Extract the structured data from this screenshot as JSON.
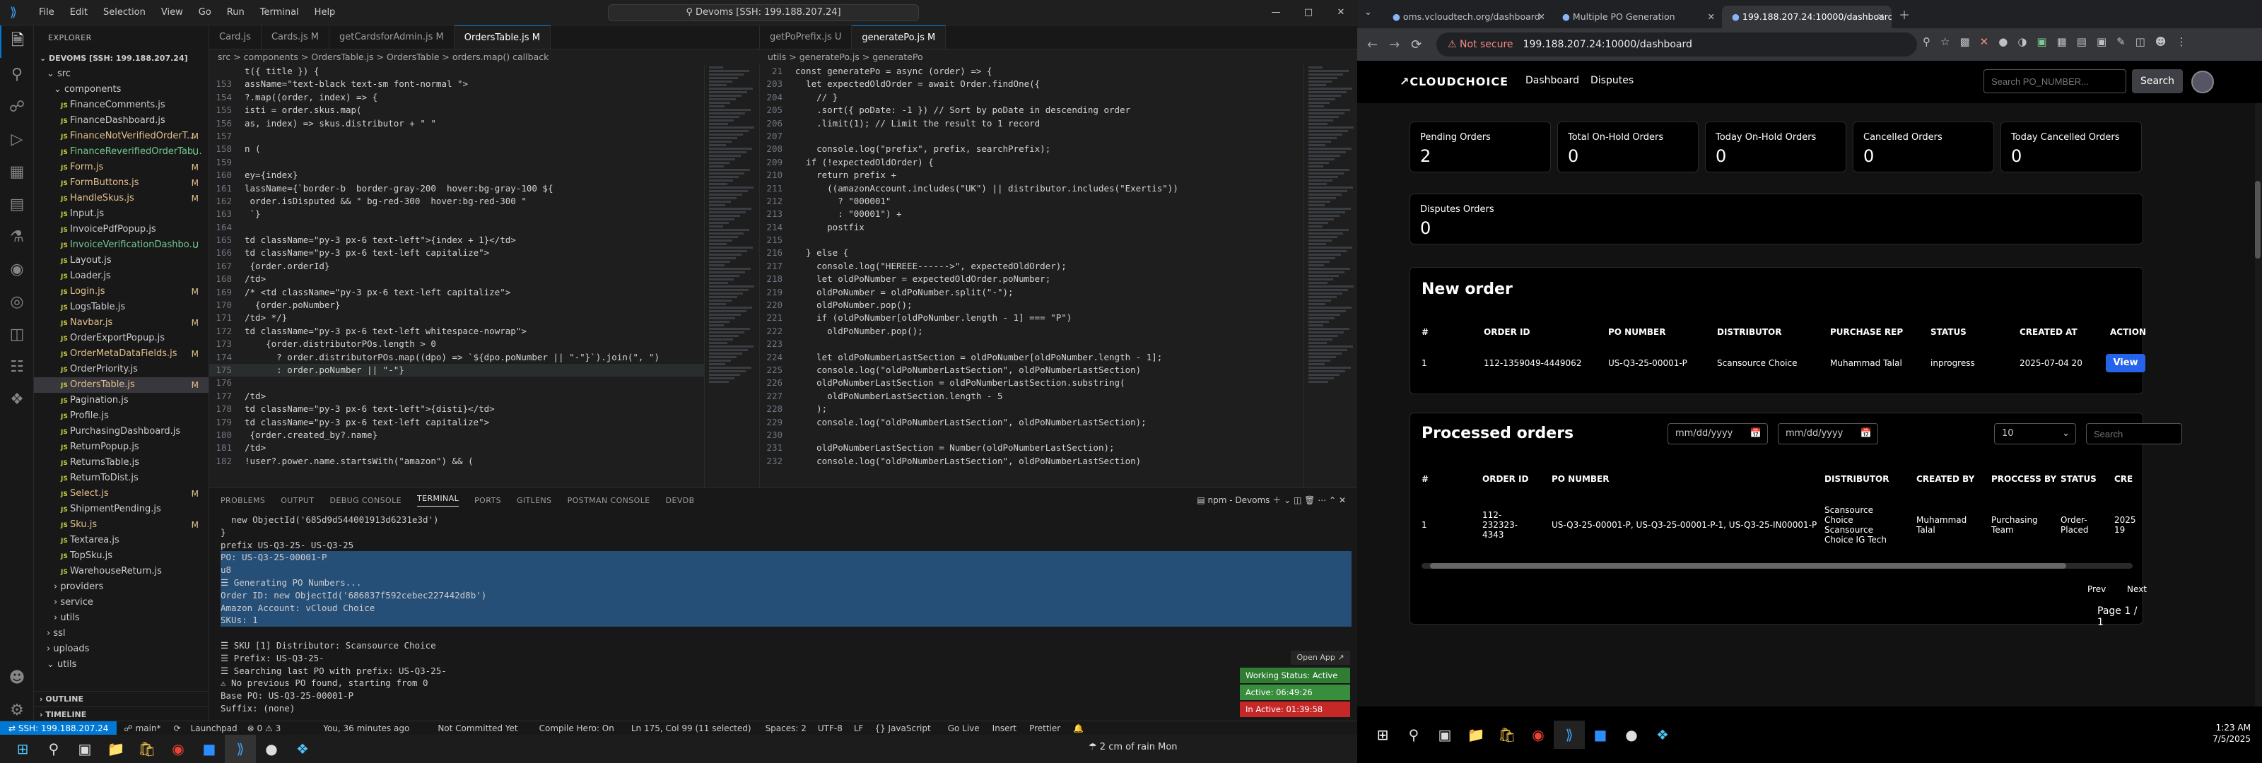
{
  "vscode": {
    "menu": [
      "File",
      "Edit",
      "Selection",
      "View",
      "Go",
      "Run",
      "Terminal",
      "Help"
    ],
    "command_center": "Devoms [SSH: 199.188.207.24]",
    "explorer_title": "EXPLORER",
    "root": "DEVOMS [SSH: 199.188.207.24]",
    "files": [
      {
        "name": "src",
        "status": "",
        "indent": 1,
        "type": "folder"
      },
      {
        "name": "components",
        "status": "",
        "indent": 2,
        "type": "folder"
      },
      {
        "name": "FinanceComments.js",
        "status": "",
        "indent": 3,
        "type": "js"
      },
      {
        "name": "FinanceDashboard.js",
        "status": "",
        "indent": 3,
        "type": "js"
      },
      {
        "name": "FinanceNotVerifiedOrderT...",
        "status": "M",
        "indent": 3,
        "type": "js"
      },
      {
        "name": "FinanceReverifiedOrderTab...",
        "status": "U",
        "indent": 3,
        "type": "u"
      },
      {
        "name": "Form.js",
        "status": "M",
        "indent": 3,
        "type": "js"
      },
      {
        "name": "FormButtons.js",
        "status": "M",
        "indent": 3,
        "type": "js"
      },
      {
        "name": "HandleSkus.js",
        "status": "M",
        "indent": 3,
        "type": "js"
      },
      {
        "name": "Input.js",
        "status": "",
        "indent": 3,
        "type": "js"
      },
      {
        "name": "InvoicePdfPopup.js",
        "status": "",
        "indent": 3,
        "type": "js"
      },
      {
        "name": "InvoiceVerificationDashbo...",
        "status": "U",
        "indent": 3,
        "type": "u"
      },
      {
        "name": "Layout.js",
        "status": "",
        "indent": 3,
        "type": "js"
      },
      {
        "name": "Loader.js",
        "status": "",
        "indent": 3,
        "type": "js"
      },
      {
        "name": "Login.js",
        "status": "M",
        "indent": 3,
        "type": "js"
      },
      {
        "name": "LogsTable.js",
        "status": "",
        "indent": 3,
        "type": "js"
      },
      {
        "name": "Navbar.js",
        "status": "M",
        "indent": 3,
        "type": "js"
      },
      {
        "name": "OrderExportPopup.js",
        "status": "",
        "indent": 3,
        "type": "js"
      },
      {
        "name": "OrderMetaDataFields.js",
        "status": "M",
        "indent": 3,
        "type": "js"
      },
      {
        "name": "OrderPriority.js",
        "status": "",
        "indent": 3,
        "type": "js"
      },
      {
        "name": "OrdersTable.js",
        "status": "M",
        "indent": 3,
        "type": "js",
        "selected": true
      },
      {
        "name": "Pagination.js",
        "status": "",
        "indent": 3,
        "type": "js"
      },
      {
        "name": "Profile.js",
        "status": "",
        "indent": 3,
        "type": "js"
      },
      {
        "name": "PurchasingDashboard.js",
        "status": "",
        "indent": 3,
        "type": "js"
      },
      {
        "name": "ReturnPopup.js",
        "status": "",
        "indent": 3,
        "type": "js"
      },
      {
        "name": "ReturnsTable.js",
        "status": "",
        "indent": 3,
        "type": "js"
      },
      {
        "name": "ReturnToDist.js",
        "status": "",
        "indent": 3,
        "type": "js"
      },
      {
        "name": "Select.js",
        "status": "M",
        "indent": 3,
        "type": "js"
      },
      {
        "name": "ShipmentPending.js",
        "status": "",
        "indent": 3,
        "type": "js"
      },
      {
        "name": "Sku.js",
        "status": "M",
        "indent": 3,
        "type": "js"
      },
      {
        "name": "Textarea.js",
        "status": "",
        "indent": 3,
        "type": "js"
      },
      {
        "name": "TopSku.js",
        "status": "",
        "indent": 3,
        "type": "js"
      },
      {
        "name": "WarehouseReturn.js",
        "status": "",
        "indent": 3,
        "type": "js"
      },
      {
        "name": "providers",
        "status": "",
        "indent": 2,
        "type": "folder-c"
      },
      {
        "name": "service",
        "status": "",
        "indent": 2,
        "type": "folder-c"
      },
      {
        "name": "utils",
        "status": "",
        "indent": 2,
        "type": "folder-c"
      },
      {
        "name": "ssl",
        "status": "",
        "indent": 1,
        "type": "folder-c"
      },
      {
        "name": "uploads",
        "status": "",
        "indent": 1,
        "type": "folder-c"
      },
      {
        "name": "utils",
        "status": "",
        "indent": 1,
        "type": "folder"
      }
    ],
    "outline": "OUTLINE",
    "timeline": "TIMELINE",
    "left_tabs": [
      "Card.js",
      "Cards.js M",
      "getCardsforAdmin.js M",
      "OrdersTable.js M"
    ],
    "right_tabs": [
      "getPoPrefix.js U",
      "generatePo.js M"
    ],
    "left_crumb": "src > components > OrdersTable.js > OrdersTable > orders.map() callback",
    "right_crumb": "utils > generatePo.js > generatePo",
    "left_code": [
      {
        "n": "",
        "t": "t({ title }) {"
      },
      {
        "n": "153",
        "t": "assName=\"text-black text-sm font-normal \">"
      },
      {
        "n": "154",
        "t": "?.map((order, index) => {"
      },
      {
        "n": "155",
        "t": "isti = order.skus.map("
      },
      {
        "n": "156",
        "t": "as, index) => skus.distributor + \" \""
      },
      {
        "n": "157",
        "t": ""
      },
      {
        "n": "158",
        "t": "n ("
      },
      {
        "n": "159",
        "t": ""
      },
      {
        "n": "160",
        "t": "ey={index}"
      },
      {
        "n": "161",
        "t": "lassName={`border-b  border-gray-200  hover:bg-gray-100 ${"
      },
      {
        "n": "162",
        "t": " order.isDisputed && \" bg-red-300  hover:bg-red-300 \""
      },
      {
        "n": "163",
        "t": " `}"
      },
      {
        "n": "164",
        "t": ""
      },
      {
        "n": "165",
        "t": "td className=\"py-3 px-6 text-left\">{index + 1}</td>"
      },
      {
        "n": "166",
        "t": "td className=\"py-3 px-6 text-left capitalize\">"
      },
      {
        "n": "167",
        "t": " {order.orderId}"
      },
      {
        "n": "168",
        "t": "/td>"
      },
      {
        "n": "169",
        "t": "/* <td className=\"py-3 px-6 text-left capitalize\">"
      },
      {
        "n": "170",
        "t": "  {order.poNumber}"
      },
      {
        "n": "171",
        "t": "/td> */}"
      },
      {
        "n": "172",
        "t": "td className=\"py-3 px-6 text-left whitespace-nowrap\">"
      },
      {
        "n": "173",
        "t": "    {order.distributorPOs.length > 0"
      },
      {
        "n": "174",
        "t": "      ? order.distributorPOs.map((dpo) => `${dpo.poNumber || \"-\"}`).join(\", \")"
      },
      {
        "n": "175",
        "t": "      : order.poNumber || \"-\"}"
      },
      {
        "n": "176",
        "t": ""
      },
      {
        "n": "177",
        "t": "/td>"
      },
      {
        "n": "178",
        "t": "td className=\"py-3 px-6 text-left\">{disti}</td>"
      },
      {
        "n": "179",
        "t": "td className=\"py-3 px-6 text-left capitalize\">"
      },
      {
        "n": "180",
        "t": " {order.created_by?.name}"
      },
      {
        "n": "181",
        "t": "/td>"
      },
      {
        "n": "182",
        "t": "!user?.power.name.startsWith(\"amazon\") && ("
      }
    ],
    "right_code": [
      {
        "n": "21",
        "t": "const generatePo = async (order) => {"
      },
      {
        "n": "203",
        "t": "  let expectedOldOrder = await Order.findOne({"
      },
      {
        "n": "",
        "t": "    // }"
      },
      {
        "n": "",
        "t": "    .sort({ poDate: -1 }) // Sort by poDate in descending order"
      },
      {
        "n": "",
        "t": "    .limit(1); // Limit the result to 1 record"
      },
      {
        "n": "",
        "t": ""
      },
      {
        "n": "",
        "t": "    console.log(\"prefix\", prefix, searchPrefix);"
      },
      {
        "n": "",
        "t": "  if (!expectedOldOrder) {"
      },
      {
        "n": "",
        "t": "    return prefix +"
      },
      {
        "n": "",
        "t": "      ((amazonAccount.includes(\"UK\") || distributor.includes(\"Exertis\"))"
      },
      {
        "n": "",
        "t": "        ? \"000001\""
      },
      {
        "n": "",
        "t": "        : \"00001\") +"
      },
      {
        "n": "",
        "t": "      postfix"
      },
      {
        "n": "",
        "t": ""
      },
      {
        "n": "",
        "t": "  } else {"
      },
      {
        "n": "",
        "t": "    console.log(\"HEREEE------>\", expectedOldOrder);"
      },
      {
        "n": "",
        "t": "    let oldPoNumber = expectedOldOrder.poNumber;"
      },
      {
        "n": "",
        "t": "    oldPoNumber = oldPoNumber.split(\"-\");"
      },
      {
        "n": "",
        "t": "    oldPoNumber.pop();"
      },
      {
        "n": "",
        "t": "    if (oldPoNumber[oldPoNumber.length - 1] === \"P\")"
      },
      {
        "n": "",
        "t": "      oldPoNumber.pop();"
      },
      {
        "n": "",
        "t": ""
      },
      {
        "n": "",
        "t": "    let oldPoNumberLastSection = oldPoNumber[oldPoNumber.length - 1];"
      },
      {
        "n": "",
        "t": "    console.log(\"oldPoNumberLastSection\", oldPoNumberLastSection)"
      },
      {
        "n": "",
        "t": "    oldPoNumberLastSection = oldPoNumberLastSection.substring("
      },
      {
        "n": "",
        "t": "      oldPoNumberLastSection.length - 5"
      },
      {
        "n": "",
        "t": "    );"
      },
      {
        "n": "",
        "t": "    console.log(\"oldPoNumberLastSection\", oldPoNumberLastSection);"
      },
      {
        "n": "",
        "t": ""
      },
      {
        "n": "",
        "t": "    oldPoNumberLastSection = Number(oldPoNumberLastSection);"
      },
      {
        "n": "",
        "t": "    console.log(\"oldPoNumberLastSection\", oldPoNumberLastSection)"
      }
    ],
    "right_line_numbers": [
      "21",
      "203",
      "204",
      "205",
      "206",
      "207",
      "208",
      "209",
      "210",
      "211",
      "212",
      "213",
      "214",
      "215",
      "216",
      "217",
      "218",
      "219",
      "220",
      "221",
      "222",
      "223",
      "224",
      "225",
      "226",
      "227",
      "228",
      "229",
      "230",
      "231",
      "232"
    ],
    "panel_tabs": [
      "PROBLEMS",
      "OUTPUT",
      "DEBUG CONSOLE",
      "TERMINAL",
      "PORTS",
      "GITLENS",
      "POSTMAN CONSOLE",
      "DEVDB"
    ],
    "terminal_task": "npm - Devoms",
    "terminal": [
      {
        "t": "  new ObjectId('685d9d544001913d6231e3d')",
        "sel": false
      },
      {
        "t": "}",
        "sel": false
      },
      {
        "t": "prefix US-Q3-25- US-Q3-25",
        "sel": false
      },
      {
        "t": "PO: US-Q3-25-00001-P",
        "sel": true
      },
      {
        "t": "u8",
        "sel": true
      },
      {
        "t": "☰ Generating PO Numbers...",
        "sel": true
      },
      {
        "t": "Order ID: new ObjectId('686837f592cebec227442d8b')",
        "sel": true
      },
      {
        "t": "Amazon Account: vCloud Choice",
        "sel": true
      },
      {
        "t": "SKUs: 1",
        "sel": true
      },
      {
        "t": "",
        "sel": false
      },
      {
        "t": "☰ SKU [1] Distributor: Scansource Choice",
        "sel": false
      },
      {
        "t": "☰ Prefix: US-Q3-25-",
        "sel": false
      },
      {
        "t": "☰ Searching last PO with prefix: US-Q3-25-",
        "sel": false
      },
      {
        "t": "⚠ No previous PO found, starting from 0",
        "sel": false
      },
      {
        "t": "Base PO: US-Q3-25-00001-P",
        "sel": false
      },
      {
        "t": "Suffix: (none)",
        "sel": false
      }
    ],
    "terminal_overlay": {
      "open_app": "Open App ↗",
      "working": "Working Status: Active",
      "active": "Active: 06:49:26",
      "inactive": "In Active: 01:39:58"
    },
    "status": {
      "remote": "SSH: 199.188.207.24",
      "branch": "main*",
      "launchpad": "Launchpad",
      "errors": "0 ⚠ 3",
      "blame": "You, 36 minutes ago",
      "commit": "Not Committed Yet",
      "compile": "Compile Hero: On",
      "position": "Ln 175, Col 99 (11 selected)",
      "spaces": "Spaces: 2",
      "encoding": "UTF-8",
      "eol": "LF",
      "lang": "{} JavaScript",
      "golive": "Go Live",
      "insert": "Insert",
      "prettier": "Prettier",
      "weather": "2 cm of rain Mon"
    }
  },
  "chrome": {
    "tabs": [
      {
        "title": "oms.vcloudtech.org/dashboard",
        "active": false
      },
      {
        "title": "Multiple PO Generation",
        "active": false
      },
      {
        "title": "199.188.207.24:10000/dashboard",
        "active": true
      }
    ],
    "security": "Not secure",
    "url": "199.188.207.24:10000/dashboard",
    "app": {
      "logo": "CLOUDCHOICE",
      "nav": [
        "Dashboard",
        "Disputes"
      ],
      "search_placeholder": "Search PO_NUMBER...",
      "search_btn": "Search",
      "stats": [
        {
          "label": "Pending Orders",
          "value": "2"
        },
        {
          "label": "Total On-Hold Orders",
          "value": "0"
        },
        {
          "label": "Today On-Hold Orders",
          "value": "0"
        },
        {
          "label": "Cancelled Orders",
          "value": "0"
        },
        {
          "label": "Today Cancelled Orders",
          "value": "0"
        },
        {
          "label": "Disputes Orders",
          "value": "0"
        }
      ],
      "new_order": {
        "title": "New order",
        "headers": [
          "#",
          "ORDER ID",
          "PO NUMBER",
          "DISTRIBUTOR",
          "PURCHASE REP",
          "STATUS",
          "CREATED AT",
          "ACTION"
        ],
        "rows": [
          [
            "1",
            "112-1359049-4449062",
            "US-Q3-25-00001-P",
            "Scansource Choice",
            "Muhammad Talal",
            "inprogress",
            "2025-07-04 20",
            "View"
          ]
        ]
      },
      "processed": {
        "title": "Processed orders",
        "date_placeholder": "mm/dd/yyyy",
        "per_page": "10",
        "search_placeholder": "Search",
        "headers": [
          "#",
          "ORDER ID",
          "PO NUMBER",
          "DISTRIBUTOR",
          "CREATED BY",
          "PROCCESS BY",
          "STATUS",
          "CRE"
        ],
        "rows": [
          [
            "1",
            "112-\n232323-\n4343",
            "US-Q3-25-00001-P, US-Q3-25-00001-P-1, US-Q3-25-IN00001-P",
            "Scansource\nChoice\nScansource\nChoice IG Tech",
            "Muhammad\nTalal",
            "Purchasing\nTeam",
            "Order-\nPlaced",
            "2025\n19"
          ]
        ],
        "prev": "Prev",
        "next": "Next",
        "page": "Page 1 / 1"
      }
    }
  },
  "taskbar": {
    "time": "1:23 AM",
    "date": "7/5/2025"
  }
}
